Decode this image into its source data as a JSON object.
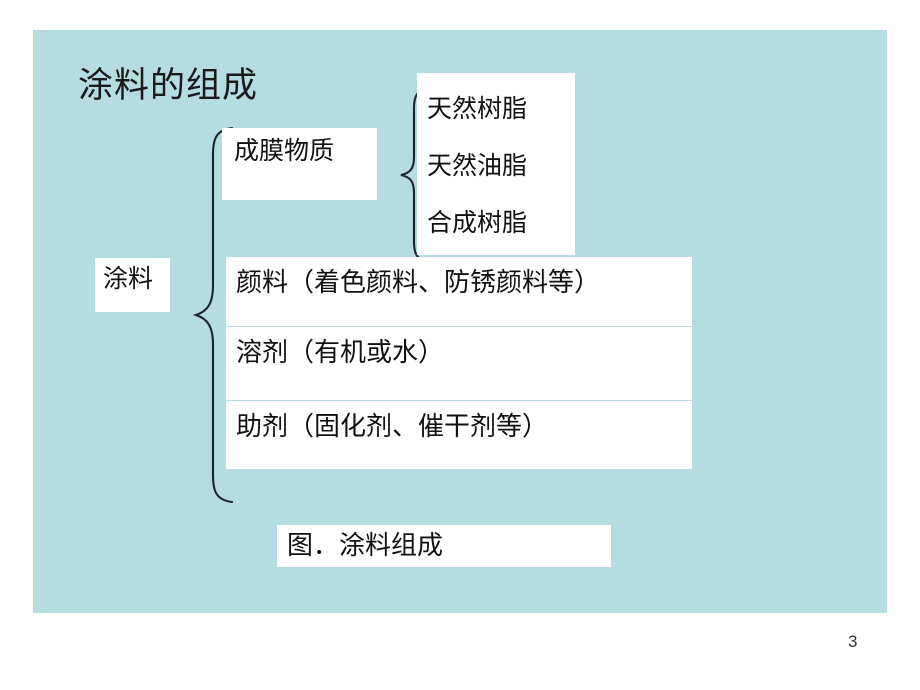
{
  "slide": {
    "title": "涂料的组成",
    "background_color": "#b5dce0",
    "page_number": "3"
  },
  "diagram": {
    "root": {
      "label": "涂料"
    },
    "film_former": {
      "label": "成膜物质",
      "children": [
        {
          "label": "天然树脂"
        },
        {
          "label": "天然油脂"
        },
        {
          "label": "合成树脂"
        }
      ]
    },
    "components": [
      {
        "label": "颜料（着色颜料、防锈颜料等）"
      },
      {
        "label": "溶剂（有机或水）"
      },
      {
        "label": "助剂（固化剂、催干剂等）"
      }
    ],
    "caption": "图．涂料组成",
    "brace_color": "#1a2530"
  }
}
